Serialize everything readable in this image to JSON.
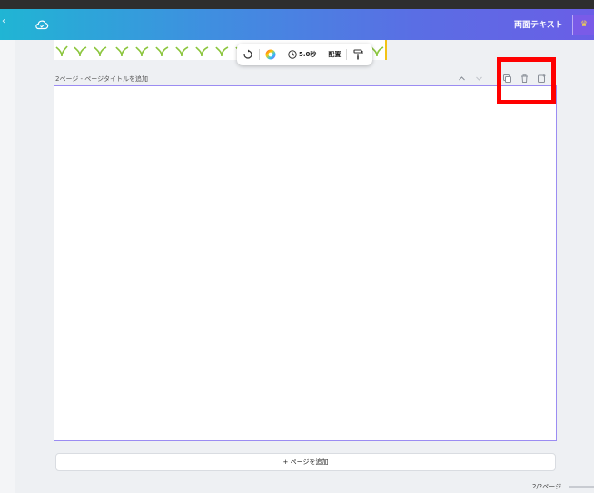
{
  "header": {
    "title": "両面テキスト",
    "accent_start": "#20b5d4",
    "accent_end": "#6a5ee6",
    "icons": [
      "chevron-icon",
      "cloud-sync-icon",
      "crown-icon"
    ]
  },
  "toolbar": {
    "duration_label": "5.0秒",
    "arrange_label": "配置",
    "icons": [
      "animate-icon",
      "color-icon",
      "clock-icon",
      "paint-roller-icon"
    ]
  },
  "page": {
    "label": "2ページ - ページタイトルを追加",
    "controls": [
      "chevron-up-icon",
      "chevron-down-icon",
      "duplicate-icon",
      "trash-icon",
      "add-page-icon"
    ],
    "canvas_border_color": "#9b8cf2"
  },
  "highlight_color": "#ff0000",
  "add_page": {
    "label": "+ ページを追加"
  },
  "footer": {
    "page_count": "2/2ページ"
  }
}
